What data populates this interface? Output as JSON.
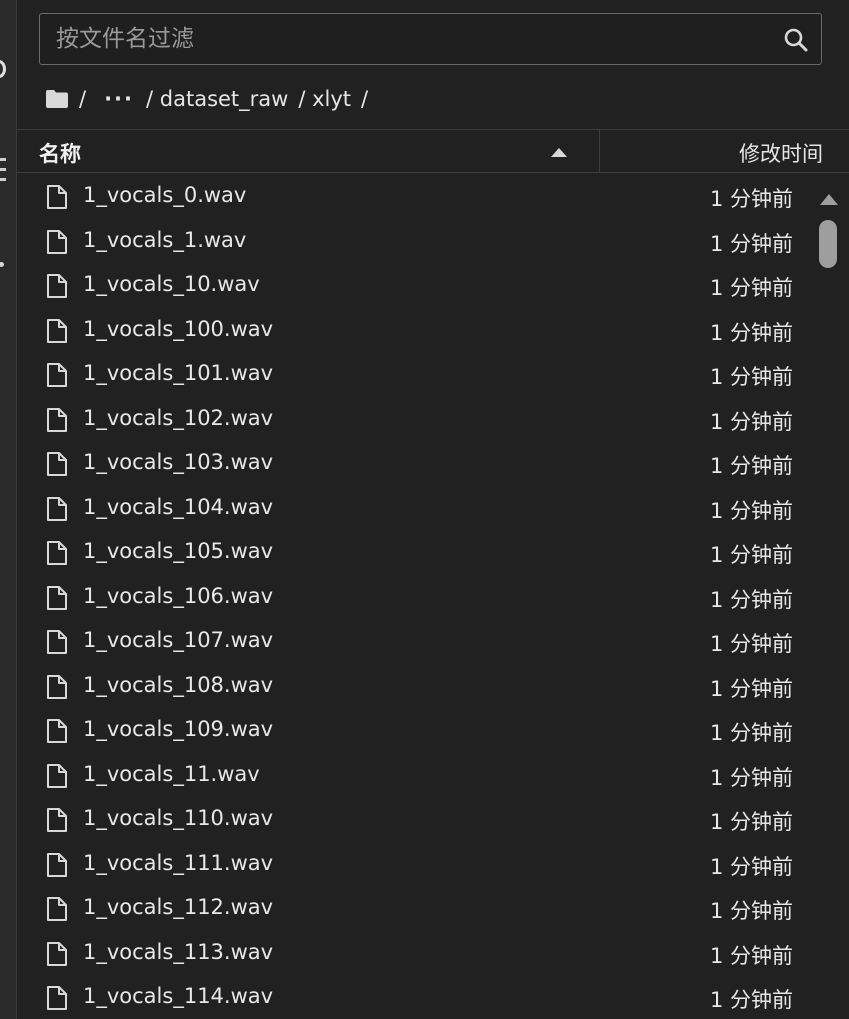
{
  "filter": {
    "placeholder": "按文件名过滤",
    "value": ""
  },
  "breadcrumb": {
    "root_sep": "/",
    "ellipsis": "···",
    "items": [
      "/ dataset_raw",
      "/ xlyt",
      "/"
    ]
  },
  "header": {
    "name_label": "名称",
    "modified_label": "修改时间",
    "sort": "ascending"
  },
  "files": [
    {
      "name": "1_vocals_0.wav",
      "modified": "1 分钟前"
    },
    {
      "name": "1_vocals_1.wav",
      "modified": "1 分钟前"
    },
    {
      "name": "1_vocals_10.wav",
      "modified": "1 分钟前"
    },
    {
      "name": "1_vocals_100.wav",
      "modified": "1 分钟前"
    },
    {
      "name": "1_vocals_101.wav",
      "modified": "1 分钟前"
    },
    {
      "name": "1_vocals_102.wav",
      "modified": "1 分钟前"
    },
    {
      "name": "1_vocals_103.wav",
      "modified": "1 分钟前"
    },
    {
      "name": "1_vocals_104.wav",
      "modified": "1 分钟前"
    },
    {
      "name": "1_vocals_105.wav",
      "modified": "1 分钟前"
    },
    {
      "name": "1_vocals_106.wav",
      "modified": "1 分钟前"
    },
    {
      "name": "1_vocals_107.wav",
      "modified": "1 分钟前"
    },
    {
      "name": "1_vocals_108.wav",
      "modified": "1 分钟前"
    },
    {
      "name": "1_vocals_109.wav",
      "modified": "1 分钟前"
    },
    {
      "name": "1_vocals_11.wav",
      "modified": "1 分钟前"
    },
    {
      "name": "1_vocals_110.wav",
      "modified": "1 分钟前"
    },
    {
      "name": "1_vocals_111.wav",
      "modified": "1 分钟前"
    },
    {
      "name": "1_vocals_112.wav",
      "modified": "1 分钟前"
    },
    {
      "name": "1_vocals_113.wav",
      "modified": "1 分钟前"
    },
    {
      "name": "1_vocals_114.wav",
      "modified": "1 分钟前"
    }
  ],
  "icons": {
    "search": "search-icon",
    "folder": "folder-icon",
    "file": "file-icon",
    "sort": "sort-ascending-icon",
    "scroll_up": "scroll-up-arrow-icon"
  },
  "colors": {
    "background": "#212121",
    "text": "#e6e6e6",
    "border": "#3c3c3c",
    "scroll_thumb": "#9e9e9e"
  }
}
